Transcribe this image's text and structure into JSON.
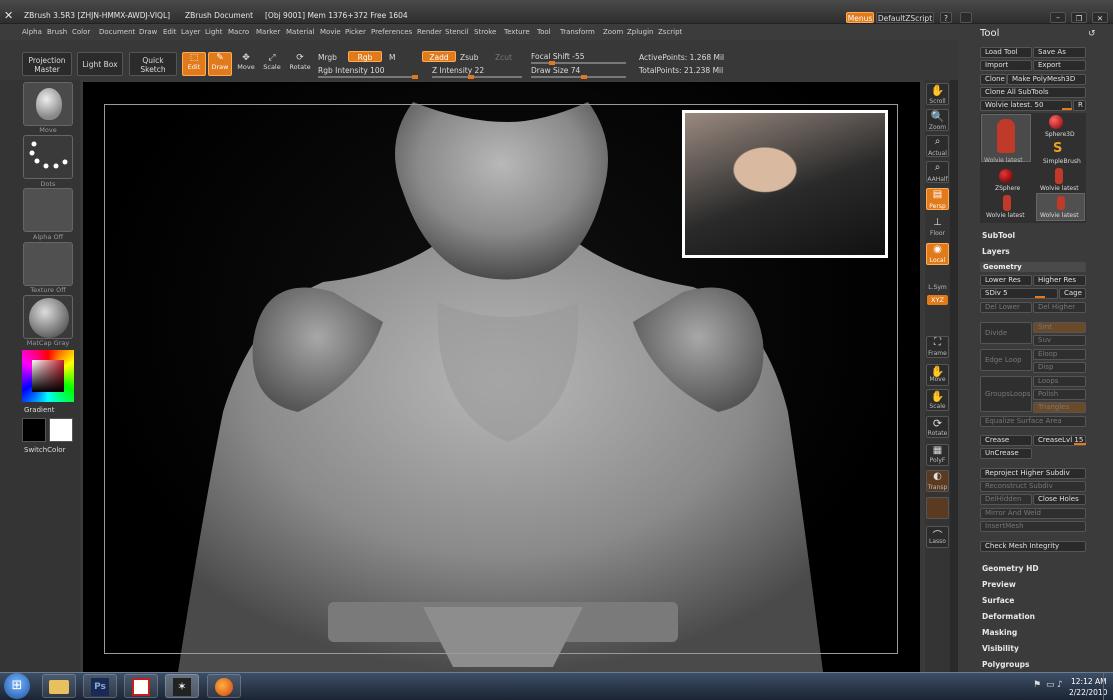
{
  "titlebar": {
    "app": "ZBrush 3.5R3 [ZHJN-HMMX-AWDJ-VIQL]",
    "doc": "ZBrush Document",
    "stats": "[Obj 9001] Mem 1376+372 Free 1604",
    "menus_btn": "Menus",
    "script_btn": "DefaultZScript"
  },
  "menu": [
    "Alpha",
    "Brush",
    "Color",
    "Document",
    "Draw",
    "Edit",
    "Layer",
    "Light",
    "Macro",
    "Marker",
    "Material",
    "Movie",
    "Picker",
    "Preferences",
    "Render",
    "Stencil",
    "Stroke",
    "Texture",
    "Tool",
    "Transform",
    "Zoom",
    "Zplugin",
    "Zscript"
  ],
  "toolbar": {
    "projection": "Projection Master",
    "lightbox": "Light Box",
    "quicksketch": "Quick Sketch",
    "edit": "Edit",
    "draw": "Draw",
    "move": "Move",
    "scale": "Scale",
    "rotate": "Rotate",
    "mrgb": "Mrgb",
    "rgb": "Rgb",
    "m": "M",
    "zadd": "Zadd",
    "zsub": "Zsub",
    "zcut": "Zcut",
    "rgb_intensity": "Rgb Intensity 100",
    "z_intensity": "Z Intensity 22",
    "focal_shift": "Focal Shift -55",
    "draw_size": "Draw Size 74",
    "active_points": "ActivePoints: 1.268 Mil",
    "total_points": "TotalPoints: 21.238 Mil"
  },
  "leftshelf": {
    "brush": "Move",
    "stroke": "Dots",
    "alpha": "Alpha Off",
    "texture": "Texture Off",
    "material": "MatCap Gray",
    "gradient": "Gradient",
    "switchcolor": "SwitchColor"
  },
  "rightshelf": [
    "Scroll",
    "Zoom",
    "Actual",
    "AAHalf",
    "Persp",
    "Floor",
    "Local",
    "L.Sym",
    "XYZ",
    "Frame",
    "Move",
    "Scale",
    "Rotate",
    "PolyF",
    "Transp",
    "Lasso"
  ],
  "panel": {
    "title": "Tool",
    "load": "Load Tool",
    "save": "Save As",
    "import": "Import",
    "export": "Export",
    "clone": "Clone",
    "make_poly": "Make PolyMesh3D",
    "clone_subtools": "Clone All SubTools",
    "current_tool": "Wolvie latest. 50",
    "r": "R",
    "tools": [
      "Wolvie latest",
      "Sphere3D",
      "SimpleBrush",
      "ZSphere",
      "Wolvie latest",
      "Wolvie latest",
      "Wolvie latest"
    ],
    "subtool": "SubTool",
    "layers": "Layers",
    "geometry": "Geometry",
    "lower_res": "Lower Res",
    "higher_res": "Higher Res",
    "sdiv": "SDiv 5",
    "cage": "Cage",
    "del_lower": "Del Lower",
    "del_higher": "Del Higher",
    "divide": "Divide",
    "smt": "Smt",
    "suv": "Suv",
    "edge_loop": "Edge Loop",
    "eloop": "Eloop",
    "disp": "Disp",
    "groups_loops": "GroupsLoops",
    "loops": "Loops",
    "polish": "Polish",
    "triangles": "Triangles",
    "equalize": "Equalize Surface Area",
    "crease": "Crease",
    "crease_lvl": "CreaseLvl 15",
    "uncrease": "UnCrease",
    "reproject": "Reproject Higher Subdiv",
    "reconstruct": "Reconstruct Subdiv",
    "delhidden": "DelHidden",
    "close_holes": "Close Holes",
    "mirror_weld": "Mirror And Weld",
    "insert_mesh": "InsertMesh",
    "check_mesh": "Check Mesh Integrity",
    "sections": [
      "Geometry HD",
      "Preview",
      "Surface",
      "Deformation",
      "Masking",
      "Visibility",
      "Polygroups"
    ]
  },
  "taskbar": {
    "time": "12:12 AM",
    "date": "2/22/2010",
    "icons": [
      "windows-start-icon",
      "explorer-icon",
      "photoshop-icon",
      "app-icon",
      "zbrush-icon",
      "firefox-icon"
    ],
    "ps": "Ps"
  },
  "colors": {
    "accent": "#e07a1a",
    "panel": "#3b3b3b",
    "viewport": "#000000"
  }
}
